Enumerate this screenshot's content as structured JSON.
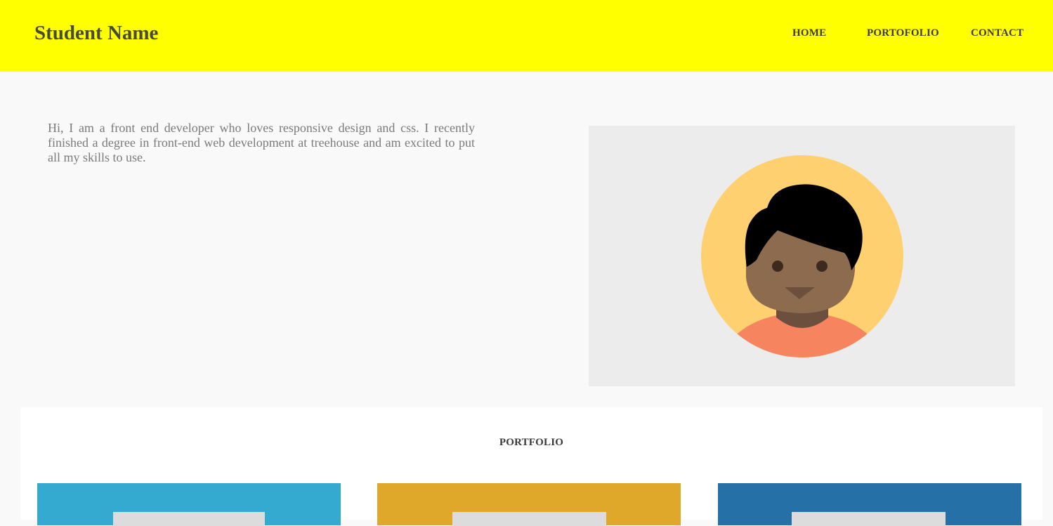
{
  "header": {
    "brand": "Student Name",
    "nav": [
      {
        "label": "HOME"
      },
      {
        "label": "PORTOFOLIO"
      },
      {
        "label": "CONTACT"
      }
    ]
  },
  "intro": {
    "text": "Hi, I am a front end developer who loves responsive design and css. I recently finished a degree in front-end web development at treehouse and am excited to put all my skills to use."
  },
  "portfolio": {
    "title": "PORTFOLIO",
    "cards": [
      {
        "color": "#35aad1"
      },
      {
        "color": "#e0a82a"
      },
      {
        "color": "#2570a6"
      }
    ]
  },
  "colors": {
    "header_bg": "#ffff00",
    "page_bg": "#f9f9f9",
    "avatar_bg": "#ffd06f"
  }
}
